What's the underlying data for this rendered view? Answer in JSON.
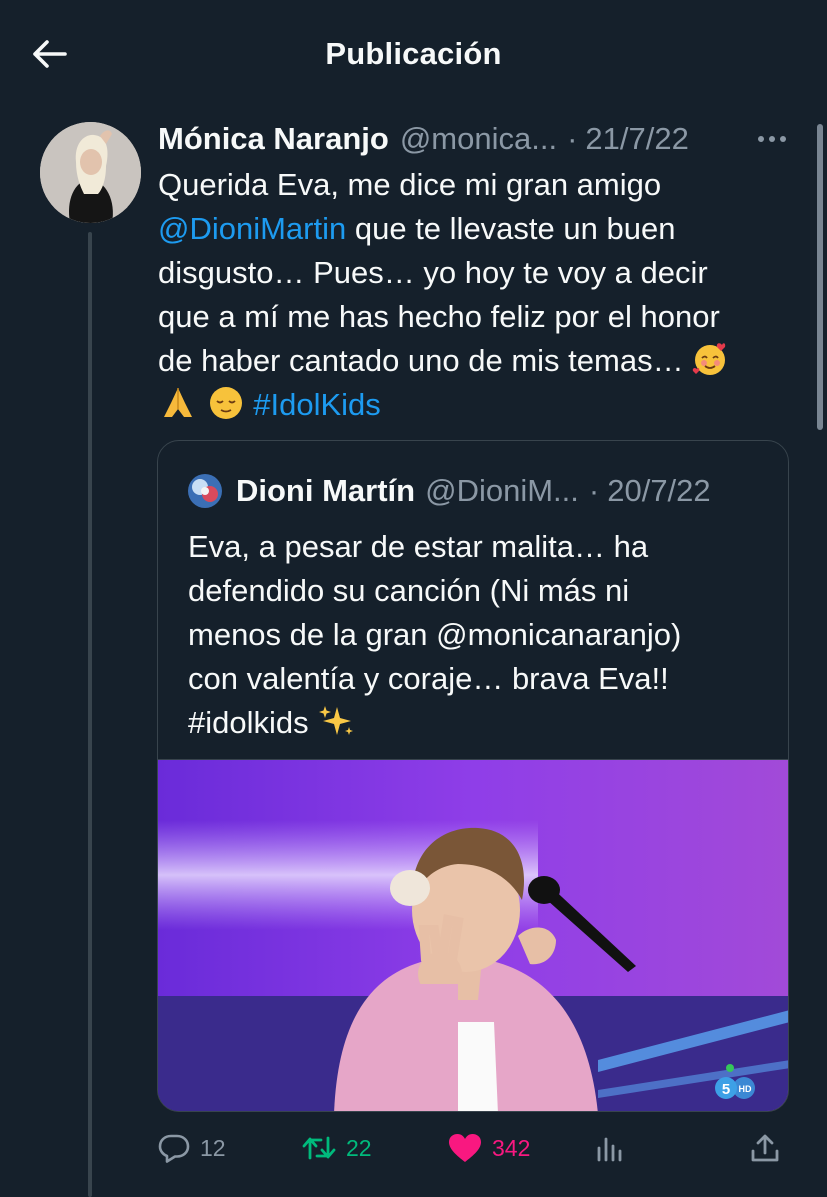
{
  "header": {
    "title": "Publicación",
    "back_icon": "arrow-left-icon"
  },
  "tweet": {
    "author_name": "Mónica Naranjo",
    "author_handle": "@monica...",
    "separator": "·",
    "date": "21/7/22",
    "more_icon": "more-horizontal-icon",
    "text": {
      "line1": "Querida Eva, me dice mi gran amigo",
      "mention": "@DioniMartin",
      "line2_rest": " que te llevaste un buen",
      "line3": "disgusto… Pues… yo hoy te voy a decir",
      "line4": "que a mí me has hecho feliz por el honor",
      "line5": "de haber cantado uno de mis temas… ",
      "emoji_1": "smiling-face-with-hearts-emoji",
      "emoji_2": "folded-hands-emoji",
      "emoji_3": "relieved-face-emoji",
      "hashtag": "#IdolKids"
    }
  },
  "quote": {
    "author_name": "Dioni Martín",
    "author_handle": "@DioniM...",
    "separator": "·",
    "date": "20/7/22",
    "text": {
      "line1": "Eva, a pesar de estar malita… ha",
      "line2": "defendido su canción (Ni más ni",
      "line3": "menos de la gran @monicanaranjo)",
      "line4": "con valentía y coraje… brava Eva!!",
      "line5": "#idolkids ",
      "emoji": "sparkles-emoji"
    },
    "media": {
      "description": "girl-singing-with-microphone-photo",
      "channel_badge": "5",
      "channel_badge_hd": "HD"
    }
  },
  "actions": {
    "reply_count": "12",
    "retweet_count": "22",
    "like_count": "342",
    "reply_icon": "reply-icon",
    "retweet_icon": "retweet-icon",
    "like_icon": "heart-icon",
    "views_icon": "views-icon",
    "share_icon": "share-icon"
  },
  "colors": {
    "background": "#15202b",
    "link": "#1d9bf0",
    "retweet": "#00ba7c",
    "like": "#f91880",
    "muted": "#8b98a5"
  }
}
